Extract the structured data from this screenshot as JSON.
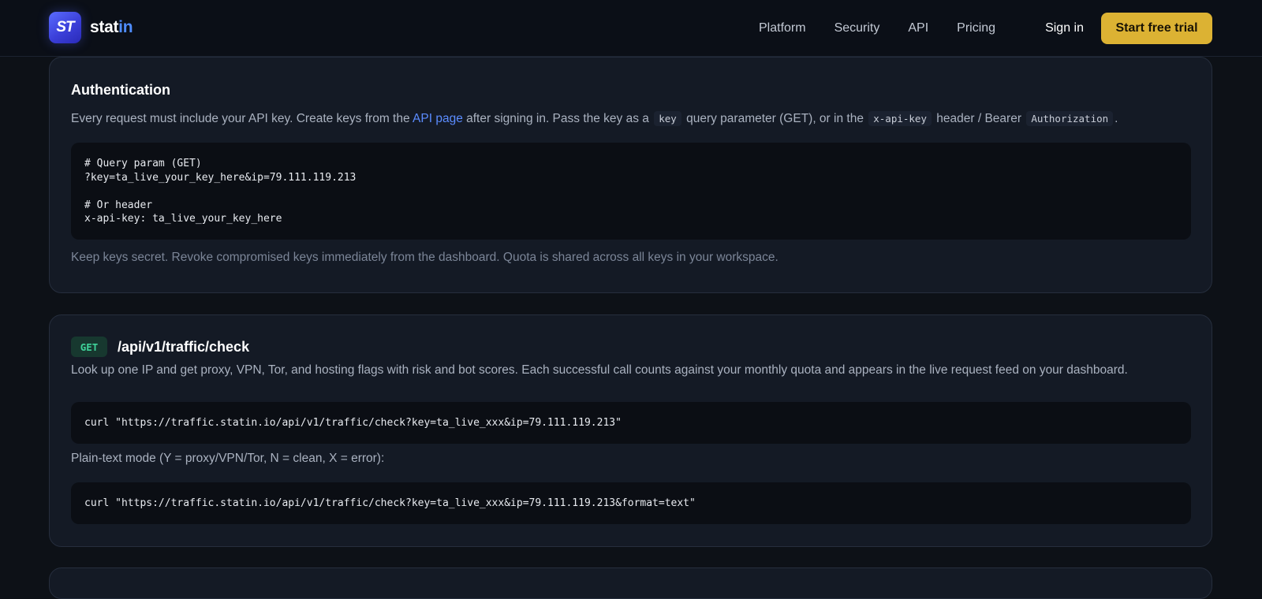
{
  "header": {
    "logo_glyph": "ST",
    "brand_prefix": "stat",
    "brand_suffix": "in",
    "nav": [
      "Platform",
      "Security",
      "API",
      "Pricing"
    ],
    "sign_in": "Sign in",
    "cta": "Start free trial"
  },
  "auth": {
    "title": "Authentication",
    "intro_1": "Every request must include your API key. Create keys from the ",
    "intro_link": "API page",
    "intro_2": " after signing in. Pass the key as a ",
    "code_key": "key",
    "intro_3": " query parameter (GET), or in the ",
    "code_header": "x-api-key",
    "intro_4": " header / Bearer ",
    "code_auth": "Authorization",
    "intro_5": ".",
    "code_lines": [
      "# Query param (GET)",
      "?key=ta_live_your_key_here&ip=79.111.119.213",
      "",
      "# Or header",
      "x-api-key: ta_live_your_key_here"
    ],
    "note": "Keep keys secret. Revoke compromised keys immediately from the dashboard. Quota is shared across all keys in your workspace."
  },
  "endpoint": {
    "method": "GET",
    "path": "/api/v1/traffic/check",
    "description": "Look up one IP and get proxy, VPN, Tor, and hosting flags with risk and bot scores. Each successful call counts against your monthly quota and appears in the live request feed on your dashboard.",
    "example_curl": "curl \"https://traffic.statin.io/api/v1/traffic/check?key=ta_live_xxx&ip=79.111.119.213\"",
    "plain_text_label": "Plain-text mode (Y = proxy/VPN/Tor, N = clean, X = error):",
    "plain_text_curl": "curl \"https://traffic.statin.io/api/v1/traffic/check?key=ta_live_xxx&ip=79.111.119.213&format=text\""
  },
  "colors": {
    "background": "#0d1117",
    "card": "#141a25",
    "accent_link": "#5b8cff",
    "cta": "#dcb233",
    "method_get": "#3fd39a"
  }
}
